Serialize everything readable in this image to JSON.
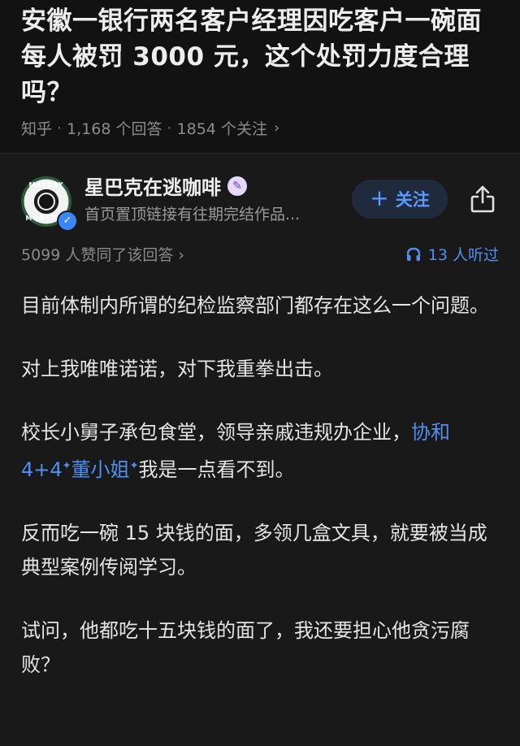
{
  "question": {
    "title": "安徽一银行两名客户经理因吃客户一碗面每人被罚 3000 元，这个处罚力度合理吗？",
    "source": "知乎",
    "answers": "1,168 个回答",
    "followers": "1854 个关注",
    "sep": "·",
    "chevron": "›"
  },
  "author": {
    "name": "星巴克在逃咖啡",
    "description": "首页置顶链接有往期完结作品...",
    "avatar_text_top": "MAYDAY",
    "avatar_text_bottom": "MONSTER",
    "verified_icon": "✓",
    "badge_icon": "✎",
    "follow_label": "关注",
    "follow_plus": "+"
  },
  "stats": {
    "upvotes": "5099 人赞同了该回答",
    "chevron": "›",
    "listen": "13 人听过"
  },
  "content": {
    "p1": "目前体制内所谓的纪检监察部门都存在这么一个问题。",
    "p2": "对上我唯唯诺诺，对下我重拳出击。",
    "p3_a": "校长小舅子承包食堂，领导亲戚违规办企业，",
    "p3_link1": "协和 4+4",
    "p3_link2": "董小姐",
    "p3_b": "我是一点看不到。",
    "spark": "✦",
    "p4": "反而吃一碗 15 块钱的面，多领几盒文具，就要被当成典型案例传阅学习。",
    "p5": "试问，他都吃十五块钱的面了，我还要担心他贪污腐败？"
  },
  "colors": {
    "background": "#121212",
    "answer_bg": "#191919",
    "link": "#4f8ff0",
    "follow_bg": "#1f2a3d"
  }
}
